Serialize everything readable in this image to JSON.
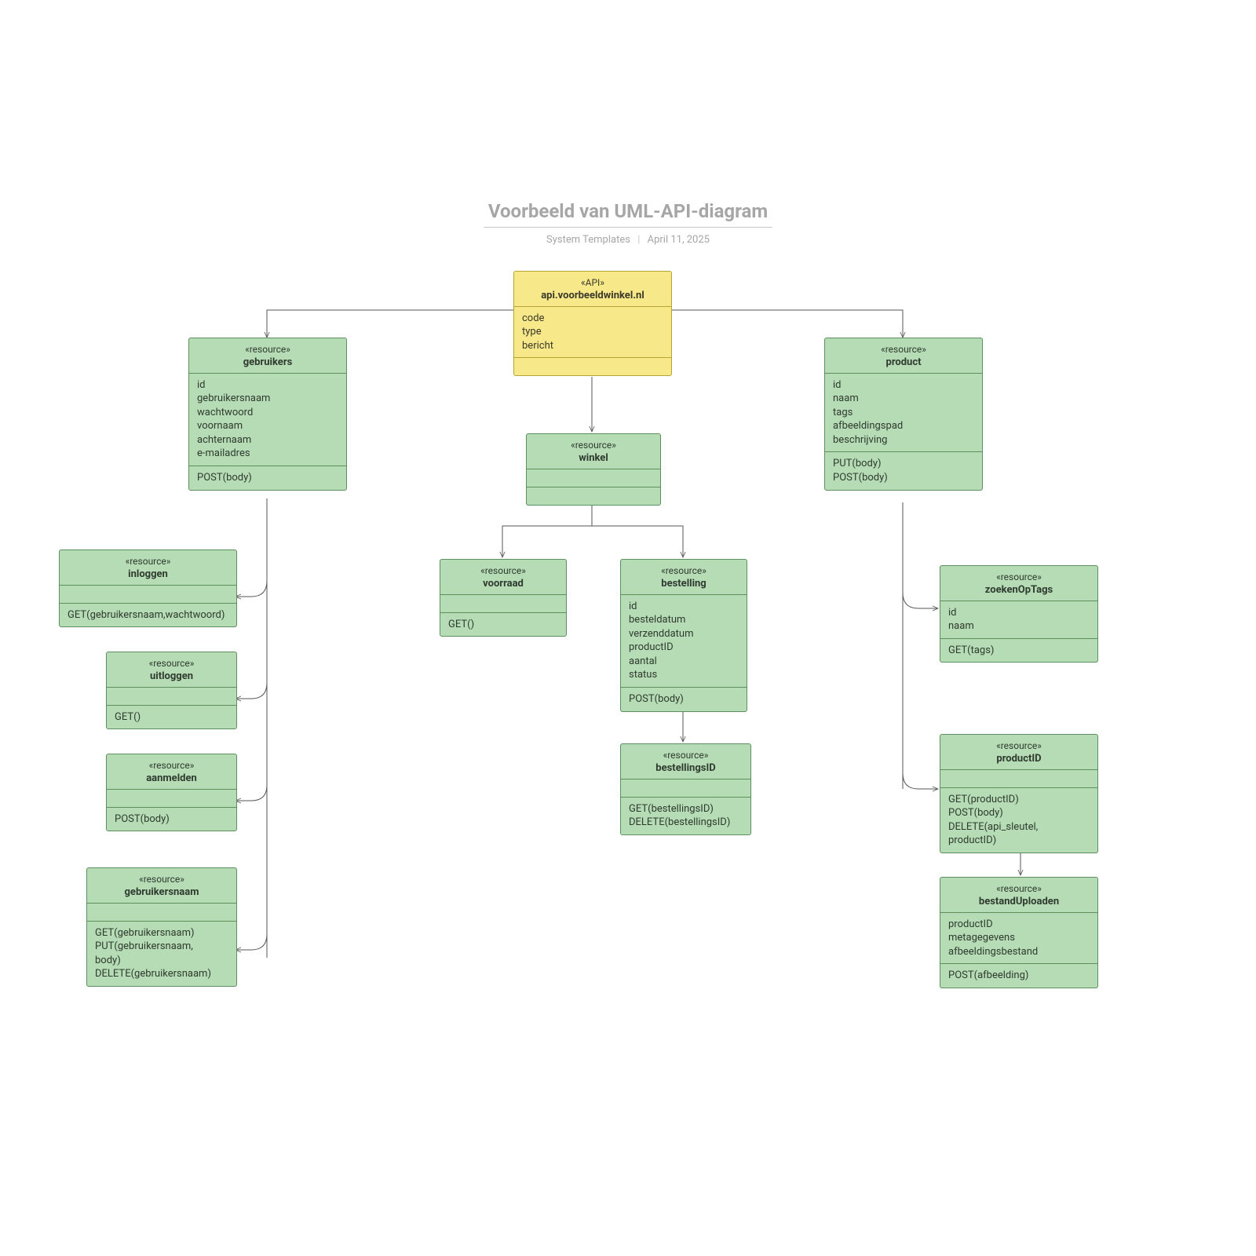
{
  "header": {
    "title": "Voorbeeld van UML-API-diagram",
    "author": "System Templates",
    "date": "April 11, 2025"
  },
  "boxes": {
    "api": {
      "stereo": "«API»",
      "name": "api.voorbeeldwinkel.nl",
      "attrs": "code\ntype\nbericht",
      "ops": ""
    },
    "gebruikers": {
      "stereo": "«resource»",
      "name": "gebruikers",
      "attrs": "id\ngebruikersnaam\nwachtwoord\nvoornaam\nachternaam\ne-mailadres",
      "ops": "POST(body)"
    },
    "product": {
      "stereo": "«resource»",
      "name": "product",
      "attrs": "id\nnaam\ntags\nafbeeldingspad\nbeschrijving",
      "ops": "PUT(body)\nPOST(body)"
    },
    "winkel": {
      "stereo": "«resource»",
      "name": "winkel",
      "attrs": "",
      "ops": ""
    },
    "voorraad": {
      "stereo": "«resource»",
      "name": "voorraad",
      "attrs": "",
      "ops": "GET()"
    },
    "bestelling": {
      "stereo": "«resource»",
      "name": "bestelling",
      "attrs": "id\nbesteldatum\nverzenddatum\nproductID\naantal\nstatus",
      "ops": "POST(body)"
    },
    "bestellingsID": {
      "stereo": "«resource»",
      "name": "bestellingsID",
      "attrs": "",
      "ops": "GET(bestellingsID)\nDELETE(bestellingsID)"
    },
    "inloggen": {
      "stereo": "«resource»",
      "name": "inloggen",
      "attrs": "",
      "ops": "GET(gebruikersnaam,wachtwoord)"
    },
    "uitloggen": {
      "stereo": "«resource»",
      "name": "uitloggen",
      "attrs": "",
      "ops": "GET()"
    },
    "aanmelden": {
      "stereo": "«resource»",
      "name": "aanmelden",
      "attrs": "",
      "ops": "POST(body)"
    },
    "gebruikersnaam": {
      "stereo": "«resource»",
      "name": "gebruikersnaam",
      "attrs": "",
      "ops": "GET(gebruikersnaam)\nPUT(gebruikersnaam,\nbody)\nDELETE(gebruikersnaam)"
    },
    "zoekenOpTags": {
      "stereo": "«resource»",
      "name": "zoekenOpTags",
      "attrs": "id\nnaam",
      "ops": "GET(tags)"
    },
    "productID": {
      "stereo": "«resource»",
      "name": "productID",
      "attrs": "",
      "ops": "GET(productID)\nPOST(body)\nDELETE(api_sleutel,\nproductID)"
    },
    "bestandUploaden": {
      "stereo": "«resource»",
      "name": "bestandUploaden",
      "attrs": "productID\nmetagegevens\nafbeeldingsbestand",
      "ops": "POST(afbeelding)"
    }
  }
}
